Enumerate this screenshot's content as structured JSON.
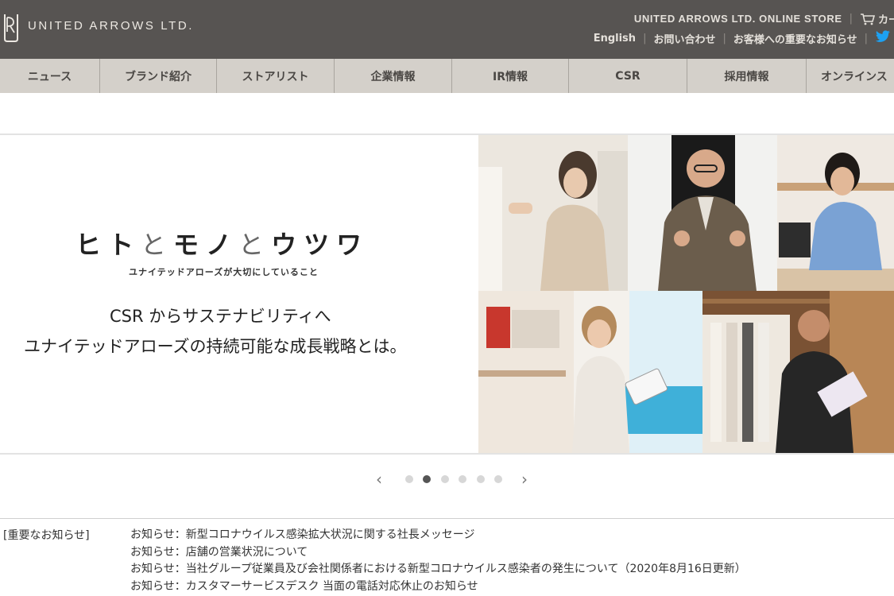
{
  "header": {
    "logo_text": "UNITED ARROWS LTD.",
    "online_store": "UNITED ARROWS LTD. ONLINE STORE",
    "cart_label": "カー",
    "links": [
      "English",
      "お問い合わせ",
      "お客様への重要なお知らせ"
    ],
    "colors": {
      "background": "#575452",
      "text": "#e4e0da",
      "twitter": "#1da1f2"
    }
  },
  "nav": {
    "items": [
      "ニュース",
      "ブランド紹介",
      "ストアリスト",
      "企業情報",
      "IR情報",
      "CSR",
      "採用情報",
      "オンラインス"
    ]
  },
  "hero": {
    "headline": {
      "part1": "ヒト",
      "amp1": "と",
      "part2": "モノ",
      "amp2": "と",
      "part3": "ウツワ"
    },
    "subtagline": "ユナイテッドアローズが大切にしていること",
    "caption_line1": "CSR からサステナビリティへ",
    "caption_line2": "ユナイテッドアローズの持続可能な成長戦略とは。"
  },
  "slider": {
    "prev_icon": "‹",
    "next_icon": "›",
    "dot_count": 6,
    "active_index": 1
  },
  "notices": {
    "label": "[重要なお知らせ]",
    "items": [
      "お知らせ：新型コロナウイルス感染拡大状況に関する社長メッセージ",
      "お知らせ：店舗の営業状況について",
      "お知らせ：当社グループ従業員及び会社関係者における新型コロナウイルス感染者の発生について（2020年8月16日更新）",
      "お知らせ：カスタマーサービスデスク 当面の電話対応休止のお知らせ"
    ]
  }
}
